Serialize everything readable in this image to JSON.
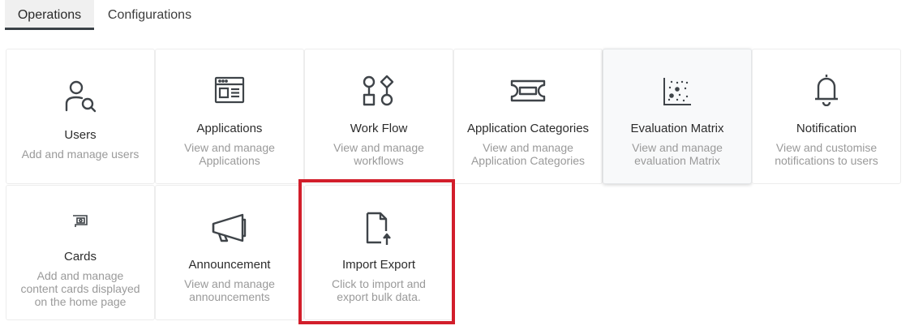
{
  "tabs": [
    {
      "label": "Operations",
      "active": true
    },
    {
      "label": "Configurations",
      "active": false
    }
  ],
  "tiles": [
    {
      "title": "Users",
      "description": [
        "Add and manage users"
      ],
      "icon": "user-search-icon"
    },
    {
      "title": "Applications",
      "description": [
        "View and manage",
        "Applications"
      ],
      "icon": "application-window-icon"
    },
    {
      "title": "Work Flow",
      "description": [
        "View and manage",
        "workflows"
      ],
      "icon": "workflow-icon"
    },
    {
      "title": "Application Categories",
      "description": [
        "View and manage",
        "Application Categories"
      ],
      "icon": "category-tag-icon"
    },
    {
      "title": "Evaluation Matrix",
      "description": [
        "View and manage",
        "evaluation Matrix"
      ],
      "icon": "scatter-matrix-icon"
    },
    {
      "title": "Notification",
      "description": [
        "View and customise",
        "notifications to users"
      ],
      "icon": "bell-icon"
    },
    {
      "title": "Cards",
      "description": [
        "Add and manage",
        "content cards displayed",
        "on the home page"
      ],
      "icon": "card-chip-icon"
    },
    {
      "title": "Announcement",
      "description": [
        "View and manage",
        "announcements"
      ],
      "icon": "megaphone-icon"
    },
    {
      "title": "Import Export",
      "description": [
        "Click to import and",
        "export bulk data."
      ],
      "icon": "file-upload-icon"
    }
  ],
  "highlight_color": "#d21e2b",
  "icon_color": "#3f4449"
}
